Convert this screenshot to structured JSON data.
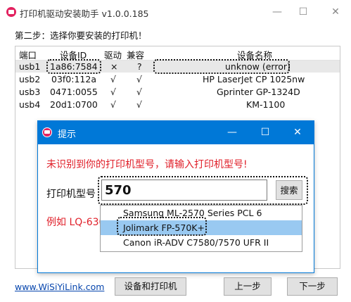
{
  "window": {
    "title": "打印机驱动安装助手 v1.0.0.185",
    "minimize": "—",
    "maximize": "☐",
    "close": "✕"
  },
  "step_label": "第二步：选择你要安装的打印机！",
  "table": {
    "columns": [
      "端口",
      "设备ID",
      "驱动",
      "兼容",
      "设备名称"
    ],
    "rows": [
      {
        "port": "usb1",
        "device_id": "1a86:7584",
        "driver": "×",
        "compat": "?",
        "name": "unknow (error)",
        "selected": true
      },
      {
        "port": "usb2",
        "device_id": "03f0:112a",
        "driver": "√",
        "compat": "√",
        "name": "HP LaserJet CP 1025nw",
        "selected": false
      },
      {
        "port": "usb3",
        "device_id": "0471:0055",
        "driver": "√",
        "compat": "√",
        "name": "Gprinter  GP-1324D",
        "selected": false
      },
      {
        "port": "usb4",
        "device_id": "20d1:0700",
        "driver": "√",
        "compat": "√",
        "name": "KM-1100",
        "selected": false
      }
    ]
  },
  "dialog": {
    "title": "提示",
    "minimize": "—",
    "maximize": "☐",
    "close": "✕",
    "warning": "未识别到你的打印机型号，请输入打印机型号!",
    "model_label": "打印机型号",
    "model_value": "570",
    "search_label": "搜索",
    "example": "例如 LQ-630"
  },
  "dropdown": {
    "options": [
      {
        "label": "Samsung ML-2570 Series PCL 6",
        "highlighted": false
      },
      {
        "label": "Jolimark FP-570K+",
        "highlighted": true
      },
      {
        "label": "Canon iR-ADV C7580/7570 UFR II",
        "highlighted": false
      }
    ]
  },
  "bottom": {
    "link": "www.WiSiYiLink.com",
    "devices_button": "设备和打印机",
    "prev_button": "上一步",
    "next_button": "下一步"
  },
  "colors": {
    "accent": "#0078d7",
    "warning_red": "#e0202a",
    "highlight": "#99c9f1",
    "app_icon": "#e2215f"
  }
}
